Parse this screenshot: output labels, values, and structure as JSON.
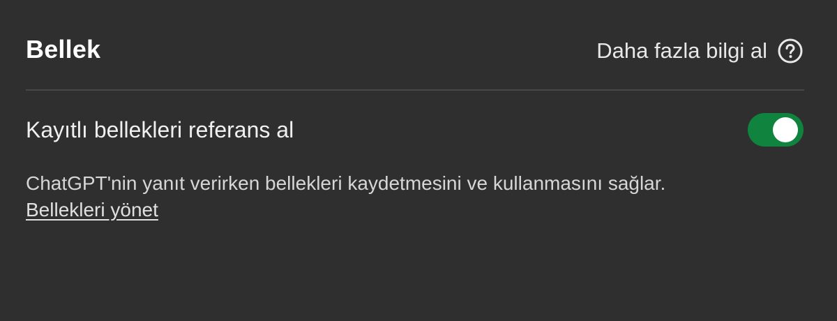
{
  "header": {
    "title": "Bellek",
    "learn_more_label": "Daha fazla bilgi al",
    "help_icon": "question-circle-icon"
  },
  "setting": {
    "label": "Kayıtlı bellekleri referans al",
    "toggle_on": true,
    "toggle_color": "#10843f",
    "description": "ChatGPT'nin yanıt verirken bellekleri kaydetmesini ve kullanmasını sağlar.",
    "manage_link": "Bellekleri yönet"
  }
}
